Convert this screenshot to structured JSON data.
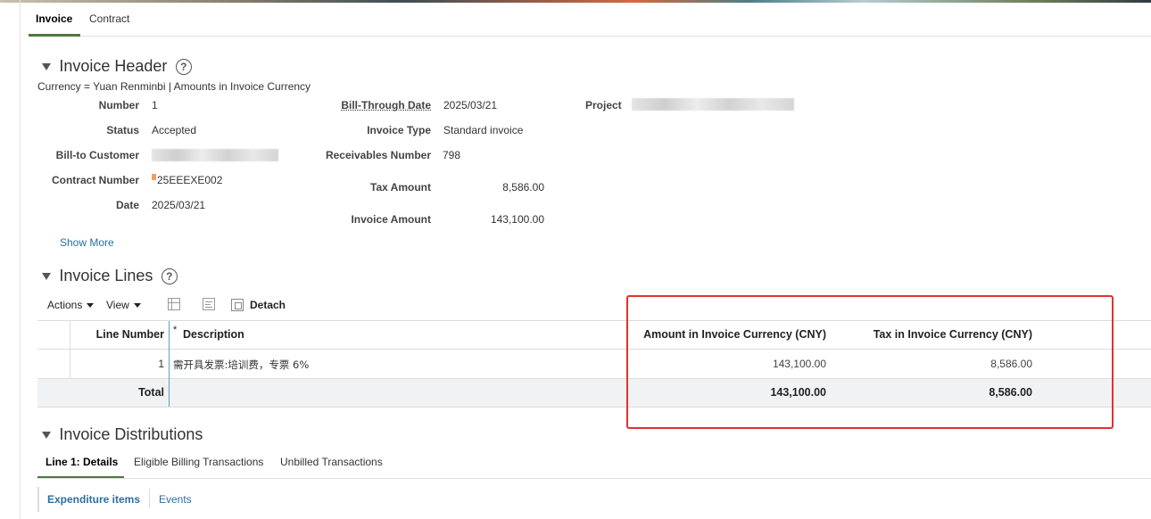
{
  "top_tabs": [
    {
      "label": "Invoice",
      "active": true
    },
    {
      "label": "Contract",
      "active": false
    }
  ],
  "invoice_header": {
    "title": "Invoice Header",
    "help": "?",
    "currency_note": "Currency = Yuan Renminbi | Amounts in Invoice Currency",
    "number_label": "Number",
    "number": "1",
    "status_label": "Status",
    "status": "Accepted",
    "bill_to_label": "Bill-to Customer",
    "contract_number_label": "Contract Number",
    "contract_number": "25EEEXE002",
    "date_label": "Date",
    "date": "2025/03/21",
    "bill_through_label": "Bill-Through Date",
    "bill_through": "2025/03/21",
    "invoice_type_label": "Invoice Type",
    "invoice_type": "Standard invoice",
    "receivables_label": "Receivables Number",
    "receivables": "798",
    "tax_amount_label": "Tax Amount",
    "tax_amount": "8,586.00",
    "invoice_amount_label": "Invoice Amount",
    "invoice_amount": "143,100.00",
    "project_label": "Project",
    "show_more": "Show More"
  },
  "invoice_lines": {
    "title": "Invoice Lines",
    "help": "?",
    "toolbar": {
      "actions": "Actions",
      "view": "View",
      "detach": "Detach"
    },
    "columns": {
      "line_number": "Line Number",
      "required_mark": "*",
      "description": "Description",
      "amount": "Amount in Invoice Currency (CNY)",
      "tax": "Tax in Invoice Currency (CNY)"
    },
    "rows": [
      {
        "line_number": "1",
        "description": "需开具发票:培训费，专票 6%",
        "amount": "143,100.00",
        "tax": "8,586.00"
      }
    ],
    "total": {
      "label": "Total",
      "amount": "143,100.00",
      "tax": "8,586.00"
    }
  },
  "invoice_distributions": {
    "title": "Invoice Distributions",
    "tabs": [
      {
        "label": "Line 1: Details",
        "active": true
      },
      {
        "label": "Eligible Billing Transactions",
        "active": false
      },
      {
        "label": "Unbilled Transactions",
        "active": false
      }
    ],
    "subtabs": [
      {
        "label": "Expenditure items",
        "active": true
      },
      {
        "label": "Events",
        "active": false
      }
    ]
  },
  "colors": {
    "accent_green": "#4a7a3e",
    "link_blue": "#2a6fa0",
    "highlight_red": "#e53030"
  }
}
